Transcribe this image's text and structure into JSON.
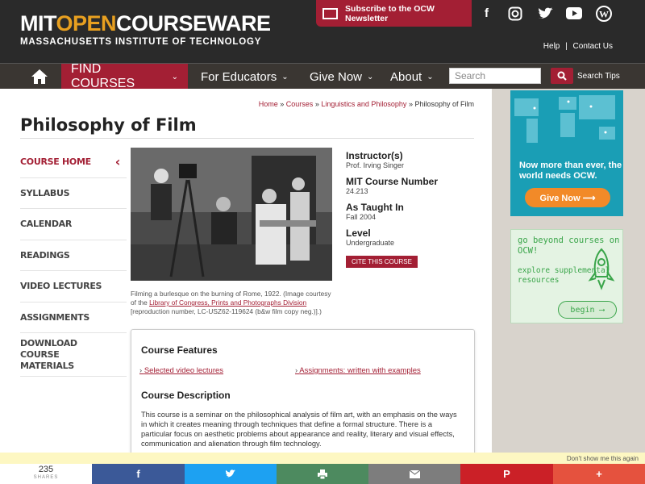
{
  "header": {
    "logo_left": "MIT",
    "logo_mid": "OPEN",
    "logo_right": "COURSEWARE",
    "logo_sub": "MASSACHUSETTS INSTITUTE OF TECHNOLOGY",
    "newsletter_label": "Subscribe to the OCW Newsletter",
    "social": [
      "facebook-icon",
      "instagram-icon",
      "twitter-icon",
      "youtube-icon",
      "wordpress-icon"
    ],
    "links": {
      "help": "Help",
      "sep": "|",
      "contact": "Contact Us"
    }
  },
  "nav": {
    "find_courses": "FIND COURSES",
    "for_educators": "For Educators",
    "give_now": "Give Now",
    "about": "About",
    "search_placeholder": "Search",
    "search_tips": "Search Tips"
  },
  "breadcrumb": {
    "home": "Home",
    "courses": "Courses",
    "dept": "Linguistics and Philosophy",
    "current": "Philosophy of Film",
    "sep": "»"
  },
  "page_title": "Philosophy of Film",
  "sidenav": [
    "COURSE HOME",
    "SYLLABUS",
    "CALENDAR",
    "READINGS",
    "VIDEO LECTURES",
    "ASSIGNMENTS",
    "DOWNLOAD COURSE MATERIALS"
  ],
  "caption": {
    "pre": "Filming a burlesque on the burning of Rome, 1922. (Image courtesy of the ",
    "link": "Library of Congress, Prints and Photographs Division",
    "post": " [reproduction number, LC-USZ62-119624 (b&w film copy neg.)].)"
  },
  "course_info": {
    "instructor_label": "Instructor(s)",
    "instructor": "Prof. Irving Singer",
    "number_label": "MIT Course Number",
    "number": "24.213",
    "taught_label": "As Taught In",
    "taught": "Fall 2004",
    "level_label": "Level",
    "level": "Undergraduate",
    "cite_button": "CITE THIS COURSE"
  },
  "features": {
    "heading": "Course Features",
    "link1": "Selected video lectures",
    "link2": "Assignments: written with examples",
    "desc_heading": "Course Description",
    "description": "This course is a seminar on the philosophical analysis of film art, with an emphasis on the ways in which it creates meaning through techniques that define a formal structure. There is a particular focus on aesthetic problems about appearance and reality, literary and visual effects, communication and alienation through film technology."
  },
  "ads": {
    "ad1_text": "Now more than ever, the world needs OCW.",
    "ad1_button": "Give Now ⟶",
    "ad2_text1": "go beyond courses on OCW!",
    "ad2_text2": "explore supplemental resources",
    "ad2_button": "begin ⟶"
  },
  "share": {
    "dont_show": "Don't show me this again",
    "count": "235",
    "count_label": "SHARES",
    "colors": {
      "facebook": "#3b5998",
      "twitter": "#1da1f2",
      "print": "#4d8a5f",
      "email": "#7d7d7d",
      "pinterest": "#cb2027",
      "more": "#e5523e"
    }
  }
}
